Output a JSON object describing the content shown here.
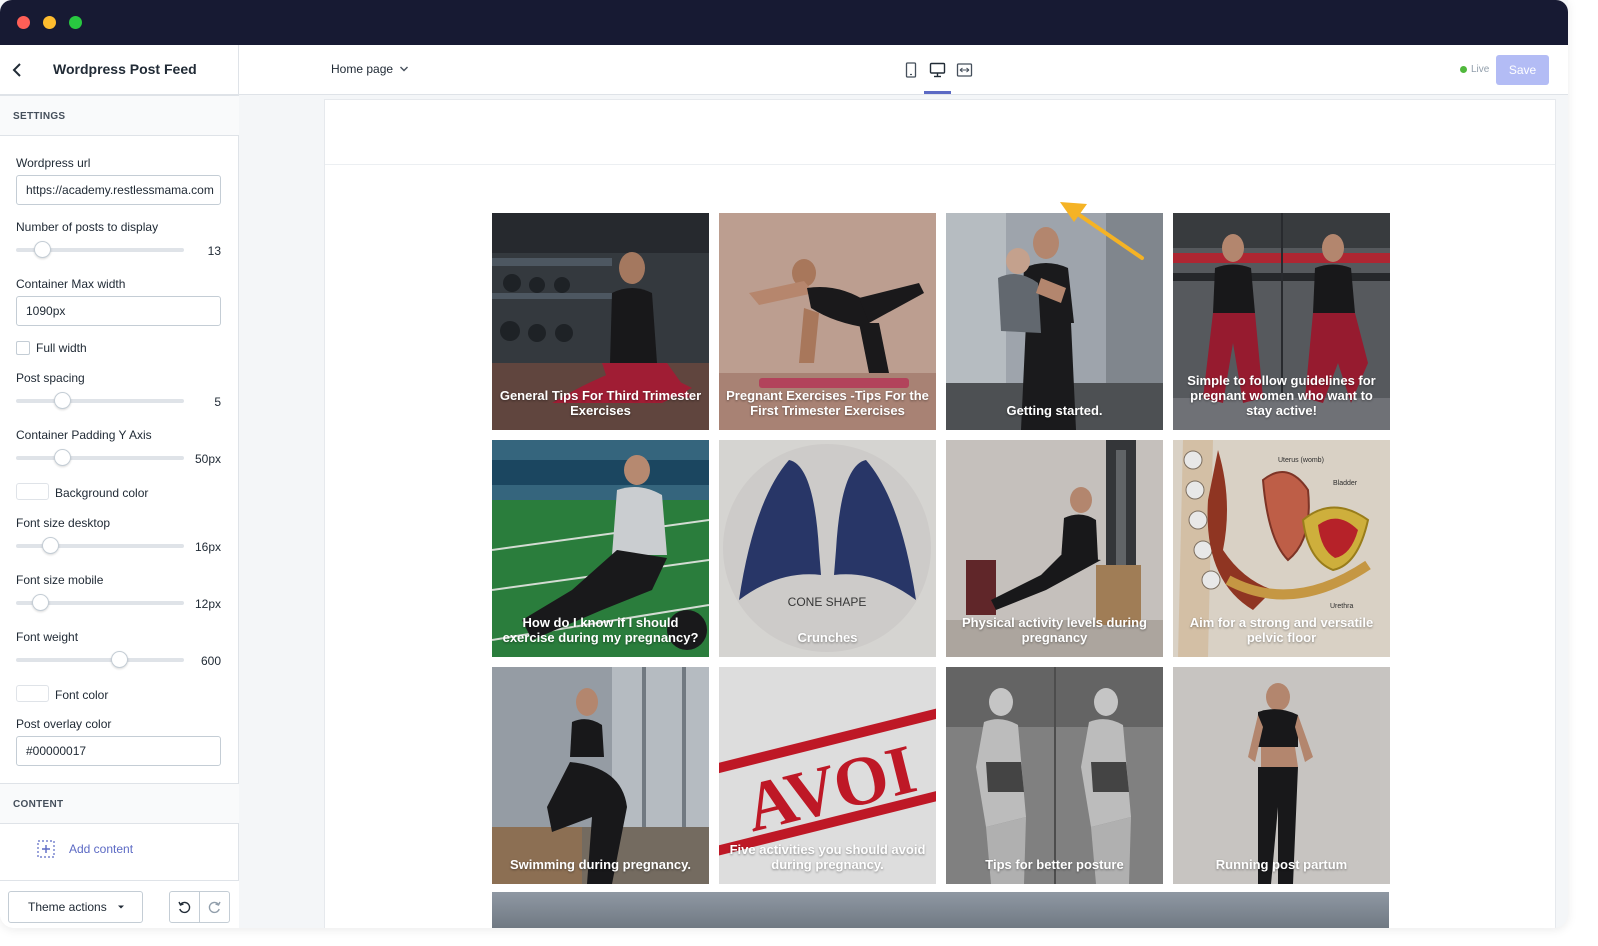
{
  "header": {
    "panel_title": "Wordpress Post Feed",
    "page_selector": "Home page",
    "live_label": "Live",
    "save_label": "Save"
  },
  "sidebar": {
    "settings_heading": "SETTINGS",
    "wordpress_url": {
      "label": "Wordpress url",
      "value": "https://academy.restlessmama.com"
    },
    "num_posts": {
      "label": "Number of posts to display",
      "value": "13"
    },
    "container_max_width": {
      "label": "Container Max width",
      "value": "1090px"
    },
    "full_width": {
      "label": "Full width",
      "checked": false
    },
    "post_spacing": {
      "label": "Post spacing",
      "value": "5"
    },
    "container_padding_y": {
      "label": "Container Padding Y Axis",
      "value": "50px"
    },
    "background_color": {
      "label": "Background color"
    },
    "font_size_desktop": {
      "label": "Font size desktop",
      "value": "16px"
    },
    "font_size_mobile": {
      "label": "Font size mobile",
      "value": "12px"
    },
    "font_weight": {
      "label": "Font weight",
      "value": "600"
    },
    "font_color": {
      "label": "Font color"
    },
    "post_overlay_color": {
      "label": "Post overlay color",
      "value": "#00000017"
    },
    "content_heading": "CONTENT",
    "add_content_label": "Add content",
    "theme_actions_label": "Theme actions"
  },
  "posts": [
    {
      "title": "General Tips For Third Trimester Exercises",
      "bg": "#3d4247"
    },
    {
      "title": "Pregnant Exercises -Tips For the First Trimester Exercises",
      "bg": "#c9a79a"
    },
    {
      "title": "Getting started.",
      "bg": "#8a8f96"
    },
    {
      "title": "Simple to follow guidelines for pregnant women who want to stay active!",
      "bg": "#5b5e63"
    },
    {
      "title": "How do I know if I should exercise during my pregnancy?",
      "bg": "#2f7a3c"
    },
    {
      "title": "Crunches",
      "bg": "#ecebe9"
    },
    {
      "title": "Physical activity levels during pregnancy",
      "bg": "#d8d2cc"
    },
    {
      "title": "Aim for a strong and versatile pelvic floor",
      "bg": "#ece2d4"
    },
    {
      "title": "Swimming during pregnancy.",
      "bg": "#9aa3ad"
    },
    {
      "title": "Five activities you should avoid during pregnancy.",
      "bg": "#f1f1f1"
    },
    {
      "title": "Tips for better posture",
      "bg": "#8c8c8c"
    },
    {
      "title": "Running post partum",
      "bg": "#d9d6d3"
    }
  ],
  "image_text": {
    "cone_shape": "CONE SHAPE",
    "avoid": "AVOI",
    "uterus": "Uterus (womb)",
    "bladder": "Bladder",
    "urethra": "Urethra"
  },
  "colors": {
    "accent": "#5c6ac4",
    "titlebar": "#171a33",
    "arrow": "#f5b325",
    "save_disabled": "#b3bcf5"
  }
}
